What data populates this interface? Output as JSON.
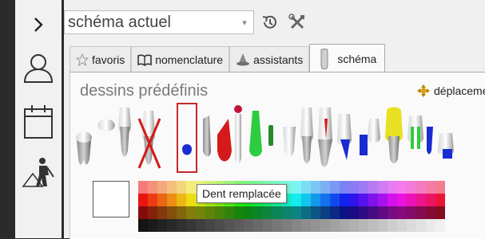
{
  "sidebar": {
    "items": [
      {
        "name": "expand-chevron-icon"
      },
      {
        "name": "user-icon"
      },
      {
        "name": "calendar-icon"
      },
      {
        "name": "construction-worker-icon"
      }
    ]
  },
  "header": {
    "combo_value": "schéma actuel",
    "combo_arrow": "▾"
  },
  "tabs": [
    {
      "label": "favoris",
      "icon": "star-icon"
    },
    {
      "label": "nomenclature",
      "icon": "book-icon"
    },
    {
      "label": "assistants",
      "icon": "wizard-hat-icon"
    },
    {
      "label": "schéma",
      "icon": "tooth-icon",
      "active": true
    }
  ],
  "panel": {
    "title": "dessins prédéfinis",
    "move_label": "déplacement"
  },
  "tooltip": "Dent remplacée",
  "drawings": [
    "dent-molaire",
    "couronne",
    "dent-incisive",
    "dent-extraite",
    "dent-remplacee",
    "racine",
    "dent-rouge",
    "dent-verte",
    "vis-implant",
    "dent",
    "dent-canal-rouge",
    "dent-canal-bleu",
    "implant-bleu",
    "dent-jaune",
    "dent-canaux-verts",
    "dent-bleue"
  ],
  "colors": {
    "selection": "#c62828",
    "accent_blue": "#1a2bd0",
    "accent_red": "#d41a1a",
    "accent_green": "#2ecc40",
    "accent_yellow": "#e8e023"
  }
}
